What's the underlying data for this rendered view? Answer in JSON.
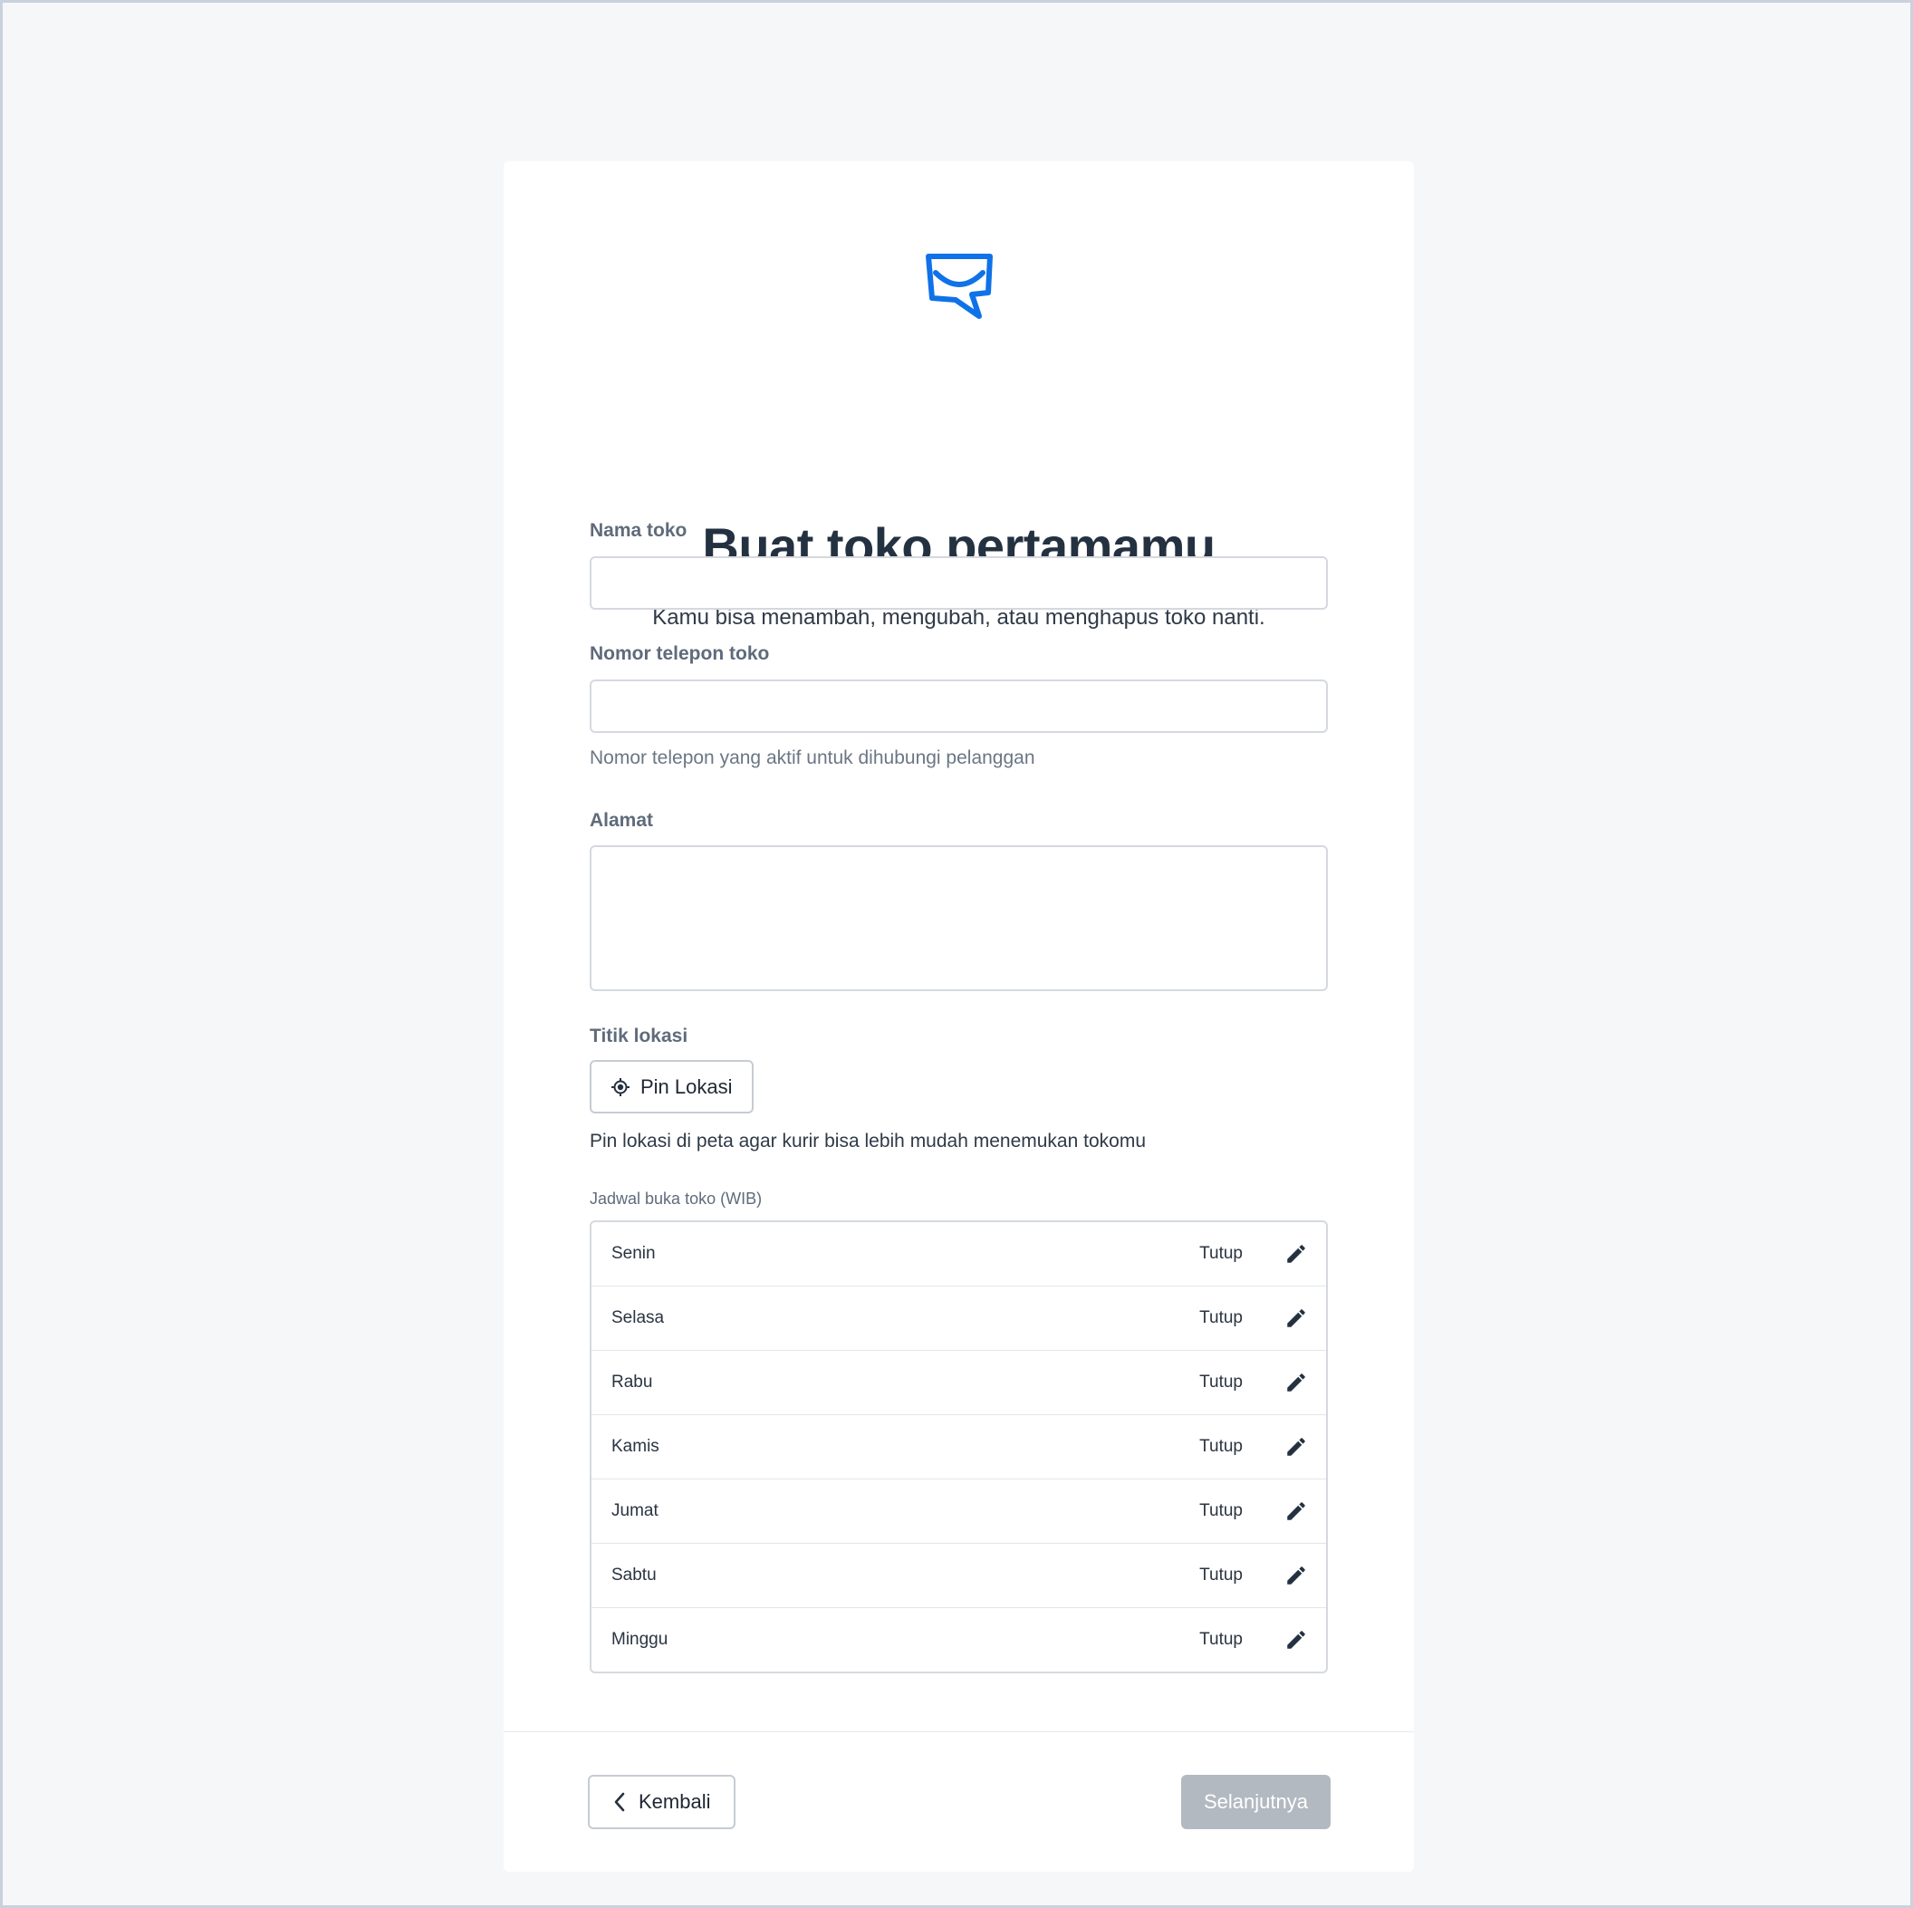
{
  "header": {
    "title": "Buat toko pertamamu",
    "subtitle": "Kamu bisa menambah, mengubah, atau menghapus toko nanti."
  },
  "form": {
    "store_name": {
      "label": "Nama toko",
      "value": "",
      "placeholder": ""
    },
    "phone": {
      "label": "Nomor telepon toko",
      "value": "",
      "placeholder": "",
      "helper": "Nomor telepon yang aktif untuk dihubungi pelanggan"
    },
    "address": {
      "label": "Alamat",
      "value": "",
      "placeholder": ""
    },
    "location": {
      "label": "Titik lokasi",
      "button_label": "Pin Lokasi",
      "helper": "Pin lokasi di peta agar kurir bisa lebih mudah menemukan tokomu"
    }
  },
  "schedule": {
    "label": "Jadwal buka toko (WIB)",
    "days": [
      {
        "day": "Senin",
        "status": "Tutup"
      },
      {
        "day": "Selasa",
        "status": "Tutup"
      },
      {
        "day": "Rabu",
        "status": "Tutup"
      },
      {
        "day": "Kamis",
        "status": "Tutup"
      },
      {
        "day": "Jumat",
        "status": "Tutup"
      },
      {
        "day": "Sabtu",
        "status": "Tutup"
      },
      {
        "day": "Minggu",
        "status": "Tutup"
      }
    ]
  },
  "footer": {
    "back_label": "Kembali",
    "next_label": "Selanjutnya"
  },
  "icons": {
    "logo": "store-logo-icon",
    "pin": "crosshair-icon",
    "edit": "pencil-icon",
    "back": "chevron-left-icon"
  },
  "colors": {
    "brand": "#1072e8",
    "next_disabled": "#b3b9c1"
  }
}
